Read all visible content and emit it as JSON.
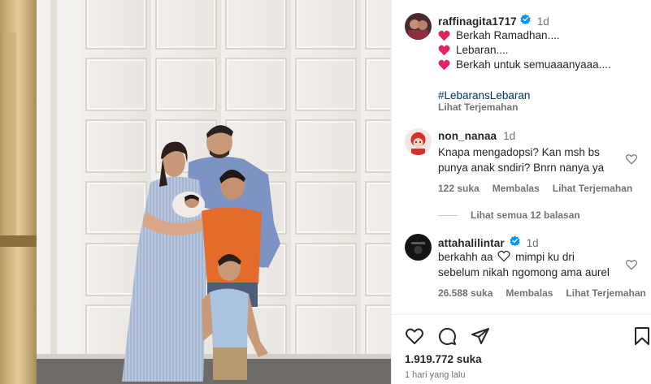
{
  "post": {
    "author": "raffinagita1717",
    "time": "1d",
    "caption_lines": [
      "Berkah Ramadhan....",
      "Lebaran....",
      "Berkah untuk semuaaanyaaa...."
    ],
    "hashtag": "#LebaransLebaran",
    "translate_label": "Lihat Terjemahan"
  },
  "comments": [
    {
      "username": "non_nanaa",
      "time": "1d",
      "verified": false,
      "text_lines": [
        "Knapa mengadopsi? Kan msh bs",
        "punya anak sndiri? Bnrn nanya ya"
      ],
      "likes": "122 suka",
      "reply_label": "Membalas",
      "translate_label": "Lihat Terjemahan"
    },
    {
      "username": "attahalilintar",
      "time": "1d",
      "verified": true,
      "text_before_icon": "berkahh aa",
      "text_after_icon": "mimpi ku dri",
      "text_line2": "sebelum nikah ngomong ama aurel",
      "likes": "26.588 suka",
      "reply_label": "Membalas",
      "translate_label": "Lihat Terjemahan"
    }
  ],
  "view_replies_label": "Lihat semua 12 balasan",
  "footer": {
    "likes_count": "1.919.772 suka",
    "date": "1 hari yang lalu"
  },
  "icons": {
    "verified": "verified-badge-icon",
    "caption_emoji": "red-heart-emoji",
    "comment_like": "heart-outline-icon",
    "actions": [
      "heart-outline-icon",
      "comment-icon",
      "share-icon",
      "bookmark-icon"
    ]
  },
  "colors": {
    "verified_blue": "#0095f6",
    "emoji_red": "#e0245e",
    "hashtag_blue": "#00376b",
    "muted_text": "#737373"
  }
}
